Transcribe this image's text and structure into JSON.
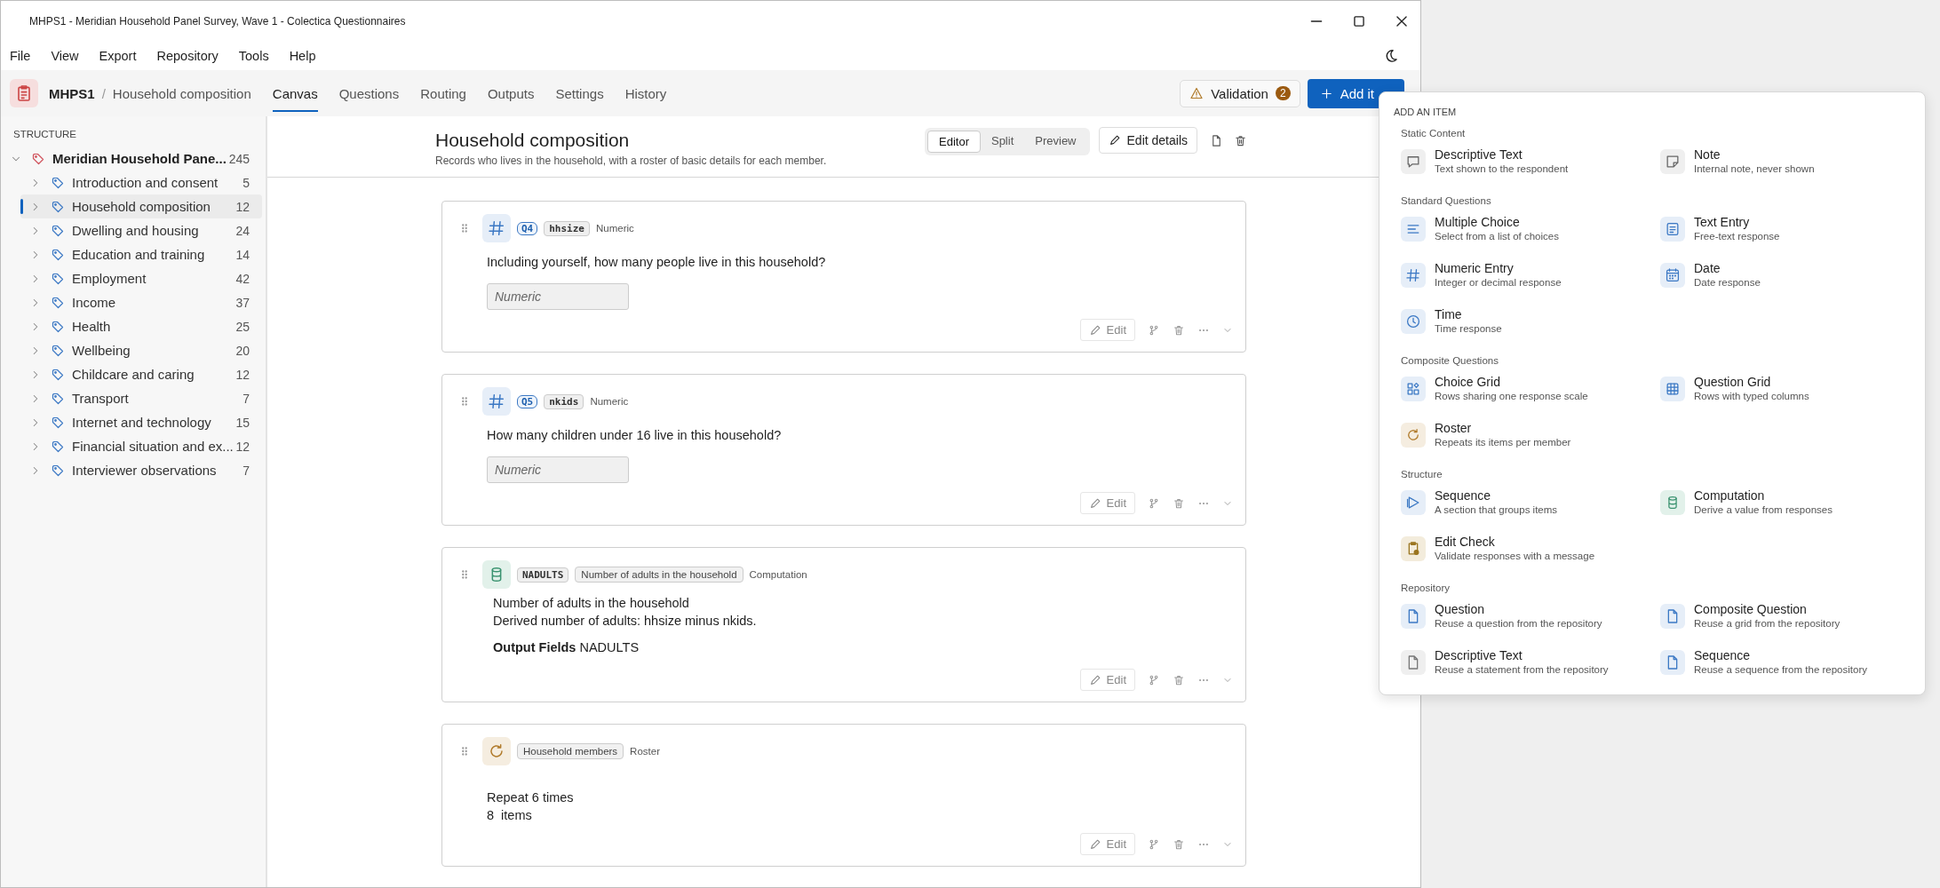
{
  "window": {
    "title": "MHPS1 - Meridian Household Panel Survey, Wave 1 - Colectica Questionnaires"
  },
  "menu": [
    "File",
    "View",
    "Export",
    "Repository",
    "Tools",
    "Help"
  ],
  "nav": {
    "project": "MHPS1",
    "separator": "/",
    "breadcrumb": "Household composition",
    "tabs": [
      {
        "label": "Canvas",
        "selected": true
      },
      {
        "label": "Questions",
        "selected": false
      },
      {
        "label": "Routing",
        "selected": false
      },
      {
        "label": "Outputs",
        "selected": false
      },
      {
        "label": "Settings",
        "selected": false
      },
      {
        "label": "History",
        "selected": false
      }
    ],
    "validation": {
      "label": "Validation",
      "count": "2"
    },
    "add_button": "Add it"
  },
  "sidebar": {
    "heading": "STRUCTURE",
    "tree": {
      "label": "Meridian Household Pane...",
      "count": "245",
      "expanded": true,
      "children": [
        {
          "label": "Introduction and consent",
          "count": "5",
          "selected": false,
          "expanded": false
        },
        {
          "label": "Household composition",
          "count": "12",
          "selected": true,
          "expanded": false
        },
        {
          "label": "Dwelling and housing",
          "count": "24",
          "selected": false,
          "expanded": false
        },
        {
          "label": "Education and training",
          "count": "14",
          "selected": false,
          "expanded": false
        },
        {
          "label": "Employment",
          "count": "42",
          "selected": false,
          "expanded": false
        },
        {
          "label": "Income",
          "count": "37",
          "selected": false,
          "expanded": false
        },
        {
          "label": "Health",
          "count": "25",
          "selected": false,
          "expanded": false
        },
        {
          "label": "Wellbeing",
          "count": "20",
          "selected": false,
          "expanded": false
        },
        {
          "label": "Childcare and caring",
          "count": "12",
          "selected": false,
          "expanded": false
        },
        {
          "label": "Transport",
          "count": "7",
          "selected": false,
          "expanded": false
        },
        {
          "label": "Internet and technology",
          "count": "15",
          "selected": false,
          "expanded": false
        },
        {
          "label": "Financial situation and ex...",
          "count": "12",
          "selected": false,
          "expanded": false
        },
        {
          "label": "Interviewer observations",
          "count": "7",
          "selected": false,
          "expanded": false
        }
      ]
    }
  },
  "page": {
    "title": "Household composition",
    "subtitle": "Records who lives in the household, with a roster of basic details for each member.",
    "view_modes": [
      {
        "label": "Editor",
        "selected": true
      },
      {
        "label": "Split",
        "selected": false
      },
      {
        "label": "Preview",
        "selected": false
      }
    ],
    "edit_details": "Edit details"
  },
  "cards": [
    {
      "kind": "question",
      "number": "Q4",
      "name": "hhsize",
      "type": "Numeric",
      "text": "Including yourself, how many people live in this household?",
      "placeholder": "Numeric",
      "edit": "Edit"
    },
    {
      "kind": "question",
      "number": "Q5",
      "name": "nkids",
      "type": "Numeric",
      "text": "How many children under 16 live in this household?",
      "placeholder": "Numeric",
      "edit": "Edit"
    },
    {
      "kind": "computation",
      "name": "NADULTS",
      "label": "Number of adults in the household",
      "type": "Computation",
      "lines": [
        "Number of adults in the household",
        "Derived number of adults: hhsize minus nkids."
      ],
      "output": "**Output Fields** NADULTS",
      "edit": "Edit"
    },
    {
      "kind": "roster",
      "label": "Household members",
      "type": "Roster",
      "lines": [
        "Repeat 6 times",
        "8  items"
      ],
      "edit": "Edit"
    }
  ],
  "add_menu": {
    "heading": "ADD AN ITEM",
    "groups": [
      {
        "title": "Static Content",
        "items": [
          {
            "kind": "statement",
            "title": "Descriptive Text",
            "description": "Text shown to the respondent"
          },
          {
            "kind": "note",
            "title": "Note",
            "description": "Internal note, never shown"
          }
        ]
      },
      {
        "title": "Standard Questions",
        "items": [
          {
            "kind": "choice",
            "title": "Multiple Choice",
            "description": "Select from a list of choices"
          },
          {
            "kind": "text",
            "title": "Text Entry",
            "description": "Free-text response"
          },
          {
            "kind": "numeric",
            "title": "Numeric Entry",
            "description": "Integer or decimal response"
          },
          {
            "kind": "date",
            "title": "Date",
            "description": "Date response"
          },
          {
            "kind": "time",
            "title": "Time",
            "description": "Time response"
          }
        ]
      },
      {
        "title": "Composite Questions",
        "items": [
          {
            "kind": "choicegrid",
            "title": "Choice Grid",
            "description": "Rows sharing one response scale"
          },
          {
            "kind": "questiongrid",
            "title": "Question Grid",
            "description": "Rows with typed columns"
          },
          {
            "kind": "roster",
            "title": "Roster",
            "description": "Repeats its items per member"
          }
        ]
      },
      {
        "title": "Structure",
        "items": [
          {
            "kind": "sequence",
            "title": "Sequence",
            "description": "A section that groups items"
          },
          {
            "kind": "computation",
            "title": "Computation",
            "description": "Derive a value from responses"
          },
          {
            "kind": "editcheck",
            "title": "Edit Check",
            "description": "Validate responses with a message"
          }
        ]
      },
      {
        "title": "Repository",
        "items": [
          {
            "kind": "reference",
            "title": "Question",
            "description": "Reuse a question from the repository"
          },
          {
            "kind": "reference",
            "title": "Composite Question",
            "description": "Reuse a grid from the repository"
          },
          {
            "kind": "statementref",
            "title": "Descriptive Text",
            "description": "Reuse a statement from the repository"
          },
          {
            "kind": "reference",
            "title": "Sequence",
            "description": "Reuse a sequence from the repository"
          }
        ]
      }
    ]
  }
}
